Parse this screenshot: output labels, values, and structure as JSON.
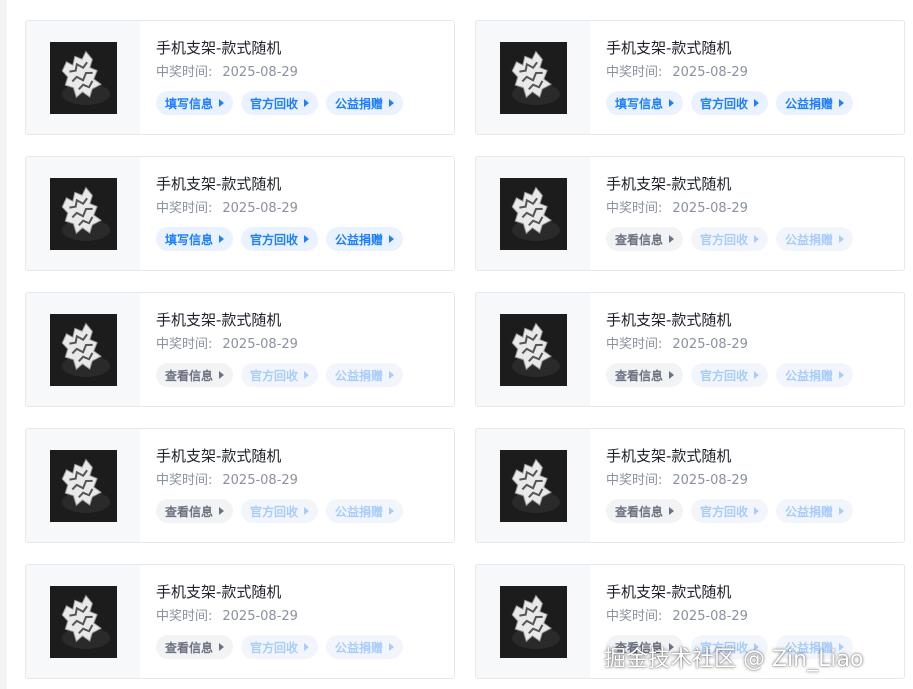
{
  "cards": [
    {
      "title": "手机支架-款式随机",
      "date_label": "中奖时间:",
      "date": "2025-08-29",
      "actions": [
        {
          "label": "填写信息",
          "state": "active"
        },
        {
          "label": "官方回收",
          "state": "active"
        },
        {
          "label": "公益捐赠",
          "state": "active"
        }
      ]
    },
    {
      "title": "手机支架-款式随机",
      "date_label": "中奖时间:",
      "date": "2025-08-29",
      "actions": [
        {
          "label": "填写信息",
          "state": "active"
        },
        {
          "label": "官方回收",
          "state": "active"
        },
        {
          "label": "公益捐赠",
          "state": "active"
        }
      ]
    },
    {
      "title": "手机支架-款式随机",
      "date_label": "中奖时间:",
      "date": "2025-08-29",
      "actions": [
        {
          "label": "填写信息",
          "state": "active"
        },
        {
          "label": "官方回收",
          "state": "active"
        },
        {
          "label": "公益捐赠",
          "state": "active"
        }
      ]
    },
    {
      "title": "手机支架-款式随机",
      "date_label": "中奖时间:",
      "date": "2025-08-29",
      "actions": [
        {
          "label": "查看信息",
          "state": "neutral"
        },
        {
          "label": "官方回收",
          "state": "disabled"
        },
        {
          "label": "公益捐赠",
          "state": "disabled"
        }
      ]
    },
    {
      "title": "手机支架-款式随机",
      "date_label": "中奖时间:",
      "date": "2025-08-29",
      "actions": [
        {
          "label": "查看信息",
          "state": "neutral"
        },
        {
          "label": "官方回收",
          "state": "disabled"
        },
        {
          "label": "公益捐赠",
          "state": "disabled"
        }
      ]
    },
    {
      "title": "手机支架-款式随机",
      "date_label": "中奖时间:",
      "date": "2025-08-29",
      "actions": [
        {
          "label": "查看信息",
          "state": "neutral"
        },
        {
          "label": "官方回收",
          "state": "disabled"
        },
        {
          "label": "公益捐赠",
          "state": "disabled"
        }
      ]
    },
    {
      "title": "手机支架-款式随机",
      "date_label": "中奖时间:",
      "date": "2025-08-29",
      "actions": [
        {
          "label": "查看信息",
          "state": "neutral"
        },
        {
          "label": "官方回收",
          "state": "disabled"
        },
        {
          "label": "公益捐赠",
          "state": "disabled"
        }
      ]
    },
    {
      "title": "手机支架-款式随机",
      "date_label": "中奖时间:",
      "date": "2025-08-29",
      "actions": [
        {
          "label": "查看信息",
          "state": "neutral"
        },
        {
          "label": "官方回收",
          "state": "disabled"
        },
        {
          "label": "公益捐赠",
          "state": "disabled"
        }
      ]
    },
    {
      "title": "手机支架-款式随机",
      "date_label": "中奖时间:",
      "date": "2025-08-29",
      "actions": [
        {
          "label": "查看信息",
          "state": "neutral"
        },
        {
          "label": "官方回收",
          "state": "disabled"
        },
        {
          "label": "公益捐赠",
          "state": "disabled"
        }
      ]
    },
    {
      "title": "手机支架-款式随机",
      "date_label": "中奖时间:",
      "date": "2025-08-29",
      "actions": [
        {
          "label": "查看信息",
          "state": "neutral"
        },
        {
          "label": "官方回收",
          "state": "disabled"
        },
        {
          "label": "公益捐赠",
          "state": "disabled"
        }
      ]
    }
  ],
  "image_icon": "phone-stand-product-image",
  "colors": {
    "active": "#1e80ff",
    "neutral": "#6b7280",
    "disabled": "#a8cdfb",
    "title": "#1d2129",
    "muted": "#8a919f"
  },
  "watermark": "掘金技术社区 @ Zin_Liao"
}
